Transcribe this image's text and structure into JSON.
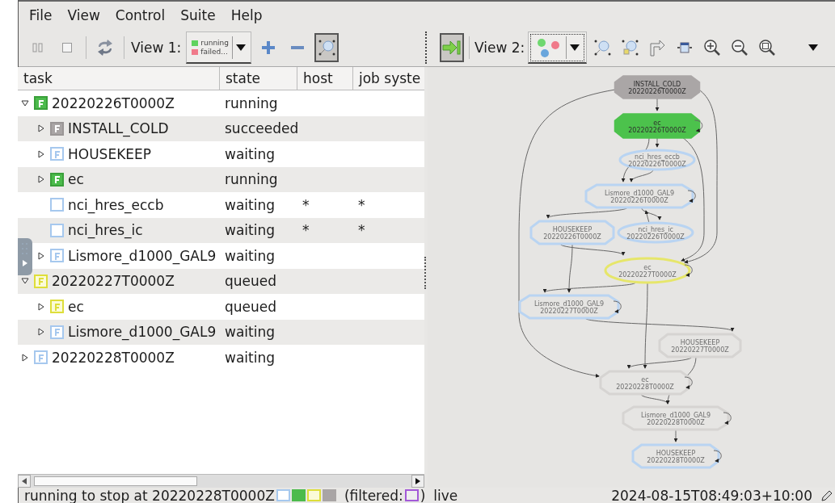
{
  "menu": [
    "File",
    "View",
    "Control",
    "Suite",
    "Help"
  ],
  "toolbar_left": {
    "view_label": "View 1:",
    "legend": [
      {
        "text": "running",
        "color": "#5fd35f"
      },
      {
        "text": "failed...",
        "color": "#f07a8a"
      }
    ],
    "graph_toggle_pressed": true
  },
  "toolbar_right": {
    "view_label": "View 2:",
    "jump_pressed": true
  },
  "table": {
    "columns": [
      "task",
      "state",
      "host",
      "job syste"
    ],
    "rows": [
      {
        "name": "20220226T0000Z",
        "kind": "family",
        "state": "running",
        "expanded": true,
        "children": [
          {
            "name": "INSTALL_COLD",
            "kind": "family",
            "state": "succeeded",
            "expanded": false
          },
          {
            "name": "HOUSEKEEP",
            "kind": "family",
            "state": "waiting",
            "expanded": false
          },
          {
            "name": "ec",
            "kind": "family",
            "state": "running",
            "expanded": false
          },
          {
            "name": "nci_hres_eccb",
            "kind": "task",
            "state": "waiting",
            "host": "*",
            "job_system": "*"
          },
          {
            "name": "nci_hres_ic",
            "kind": "task",
            "state": "waiting",
            "host": "*",
            "job_system": "*"
          },
          {
            "name": "Lismore_d1000_GAL9",
            "kind": "family",
            "state": "waiting",
            "expanded": false
          }
        ]
      },
      {
        "name": "20220227T0000Z",
        "kind": "family",
        "state": "queued",
        "expanded": true,
        "children": [
          {
            "name": "ec",
            "kind": "family",
            "state": "queued",
            "expanded": false
          },
          {
            "name": "Lismore_d1000_GAL9",
            "kind": "family",
            "state": "waiting",
            "expanded": false
          }
        ]
      },
      {
        "name": "20220228T0000Z",
        "kind": "family",
        "state": "waiting",
        "expanded": false
      }
    ]
  },
  "graph": {
    "nodes": [
      {
        "name": "INSTALL_COLD",
        "cycle": "20220226T0000Z",
        "kind": "family",
        "color": "#aaa6a6",
        "filled": true
      },
      {
        "name": "ec",
        "cycle": "20220226T0000Z",
        "kind": "family",
        "color": "#4cc24c",
        "filled": true
      },
      {
        "name": "nci_hres_eccb",
        "cycle": "20220226T0000Z",
        "kind": "task",
        "color": "#b9d4f2",
        "filled": false
      },
      {
        "name": "Lismore_d1000_GAL9",
        "cycle": "20220226T0000Z",
        "kind": "family",
        "color": "#b9d4f2",
        "filled": false
      },
      {
        "name": "HOUSEKEEP",
        "cycle": "20220226T0000Z",
        "kind": "family",
        "color": "#b9d4f2",
        "filled": false
      },
      {
        "name": "nci_hres_ic",
        "cycle": "20220226T0000Z",
        "kind": "task",
        "color": "#b9d4f2",
        "filled": false
      },
      {
        "name": "ec",
        "cycle": "20220227T0000Z",
        "kind": "task",
        "color": "#e6e66a",
        "filled": false
      },
      {
        "name": "Lismore_d1000_GAL9",
        "cycle": "20220227T0000Z",
        "kind": "family",
        "color": "#b9d4f2",
        "filled": false
      },
      {
        "name": "HOUSEKEEP",
        "cycle": "20220227T0000Z",
        "kind": "family",
        "color": "#d6d4d2",
        "filled": false
      },
      {
        "name": "ec",
        "cycle": "20220228T0000Z",
        "kind": "family",
        "color": "#d6d4d2",
        "filled": false
      },
      {
        "name": "Lismore_d1000_GAL9",
        "cycle": "20220228T0000Z",
        "kind": "family",
        "color": "#d6d4d2",
        "filled": false
      },
      {
        "name": "HOUSEKEEP",
        "cycle": "20220228T0000Z",
        "kind": "family",
        "color": "#b9d4f2",
        "filled": false
      }
    ]
  },
  "status_bar": {
    "message": "running to stop at 20220228T0000Z",
    "filtered_label": "(filtered:",
    "filtered_close": ")",
    "mode": "live",
    "time": "2024-08-15T08:49:03+10:00"
  }
}
